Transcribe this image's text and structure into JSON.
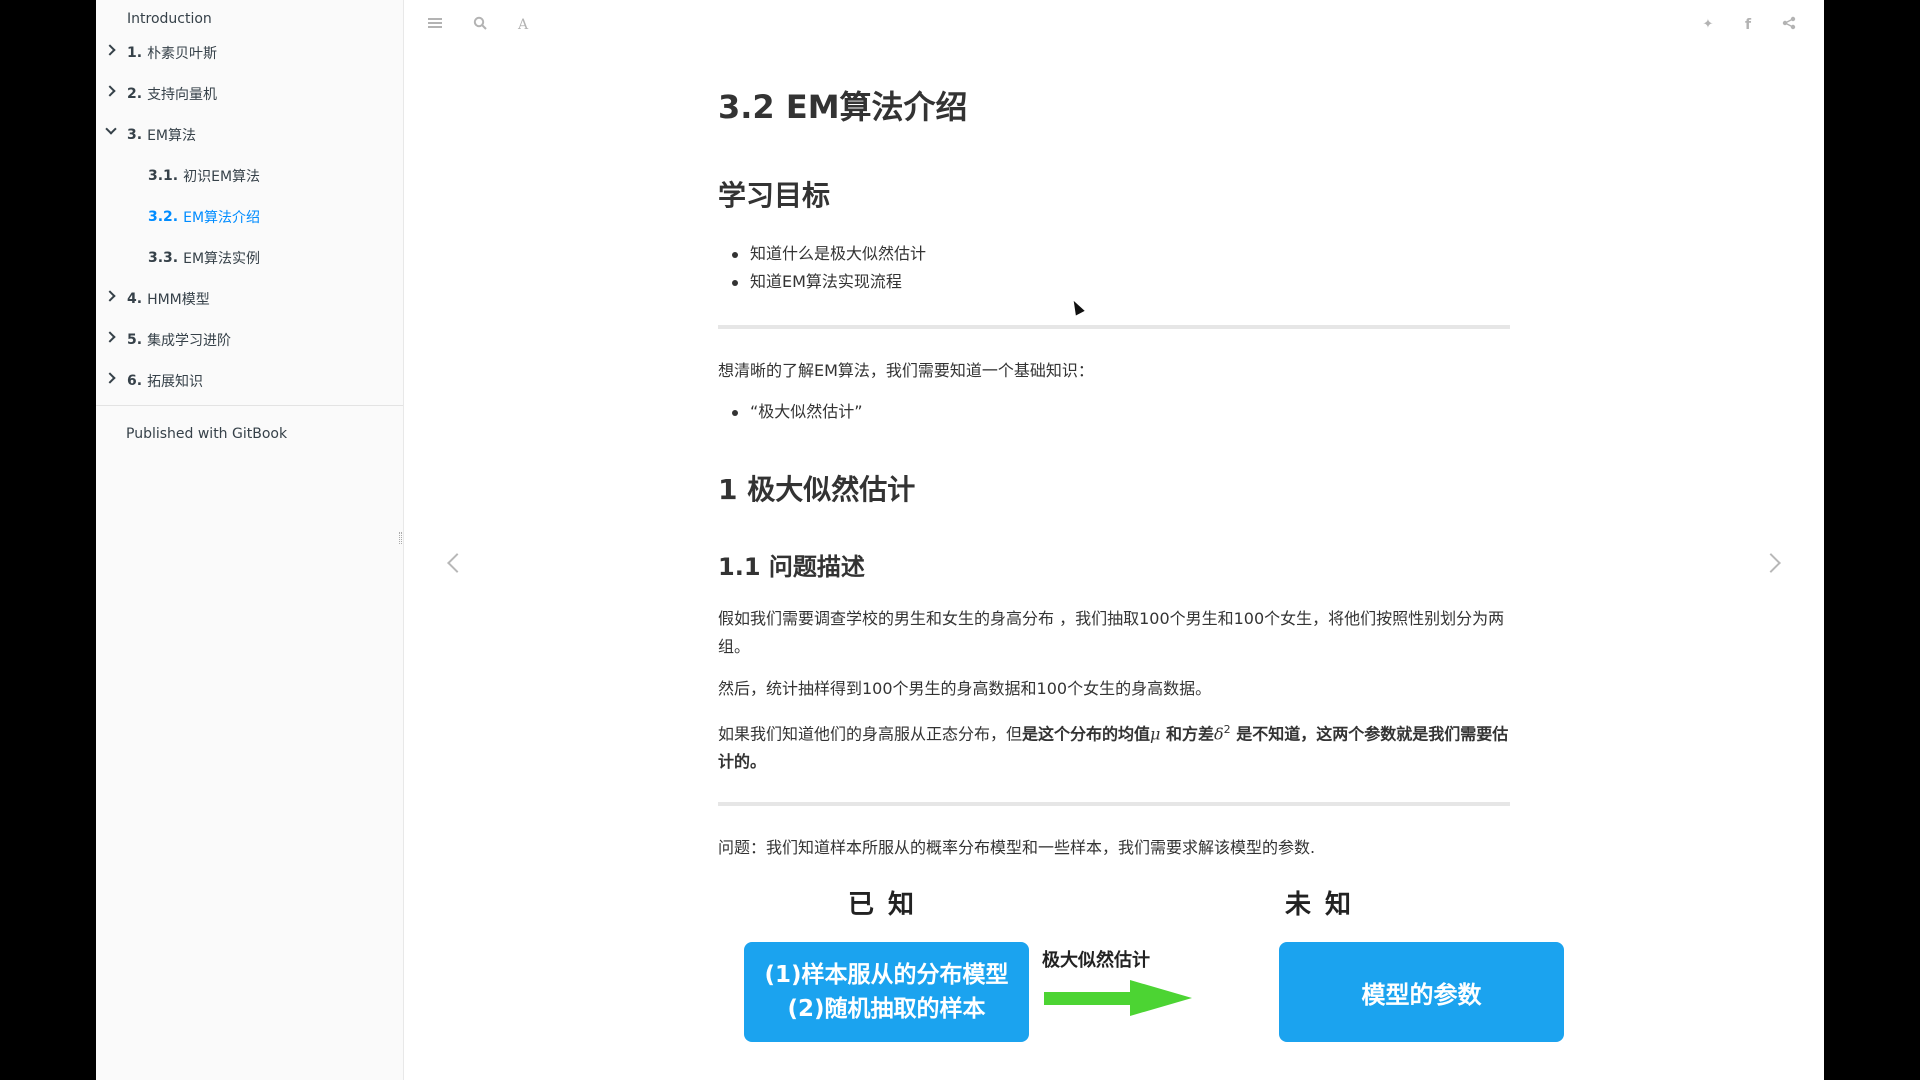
{
  "sidebar": {
    "items": [
      {
        "num": "",
        "label": "Introduction"
      },
      {
        "num": "1.",
        "label": "朴素贝叶斯"
      },
      {
        "num": "2.",
        "label": "支持向量机"
      },
      {
        "num": "3.",
        "label": "EM算法"
      },
      {
        "num": "3.1.",
        "label": "初识EM算法"
      },
      {
        "num": "3.2.",
        "label": "EM算法介绍"
      },
      {
        "num": "3.3.",
        "label": "EM算法实例"
      },
      {
        "num": "4.",
        "label": "HMM模型"
      },
      {
        "num": "5.",
        "label": "集成学习进阶"
      },
      {
        "num": "6.",
        "label": "拓展知识"
      }
    ],
    "active_item": "3.2.",
    "published": "Published with GitBook"
  },
  "toolbar": {
    "icons": [
      "menu-icon",
      "search-icon",
      "font-icon",
      "twitter-icon",
      "facebook-icon",
      "share-icon"
    ],
    "font_glyph": "A",
    "twitter_glyph": "✦",
    "facebook_glyph": "f",
    "share_glyph": "<"
  },
  "content": {
    "title": "3.2 EM算法介绍",
    "goals_heading": "学习目标",
    "goals": [
      "知道什么是极大似然估计",
      "知道EM算法实现流程"
    ],
    "intro": "想清晰的了解EM算法，我们需要知道一个基础知识：",
    "intro_items": [
      "“极大似然估计”"
    ],
    "section1_heading": "1 极大似然估计",
    "section11_heading": "1.1 问题描述",
    "p1": "假如我们需要调查学校的男生和女生的身高分布 ，我们抽取100个男生和100个女生，将他们按照性别划分为两组。",
    "p2": "然后，统计抽样得到100个男生的身高数据和100个女生的身高数据。",
    "p3_plain": "如果我们知道他们的身高服从正态分布，但",
    "p3_bold1": "是这个分布的均值",
    "p3_mu": "μ",
    "p3_bold2": " 和方差",
    "p3_delta": "δ",
    "p3_sup": "2",
    "p3_bold3": " 是不知道，这两个参数就是我们需要估计的。",
    "question": "问题：我们知道样本所服从的概率分布模型和一些样本，我们需要求解该模型的参数."
  },
  "diagram": {
    "known_label": "已知",
    "unknown_label": "未知",
    "known_line1": "(1)样本服从的分布模型",
    "known_line2": "(2)随机抽取的样本",
    "arrow_label": "极大似然估计",
    "unknown_box": "模型的参数",
    "box_color": "#1ba3ef",
    "arrow_color": "#4cd433"
  },
  "colors": {
    "accent": "#008cff",
    "text": "#333333",
    "sidebar_bg": "#fafafa"
  }
}
